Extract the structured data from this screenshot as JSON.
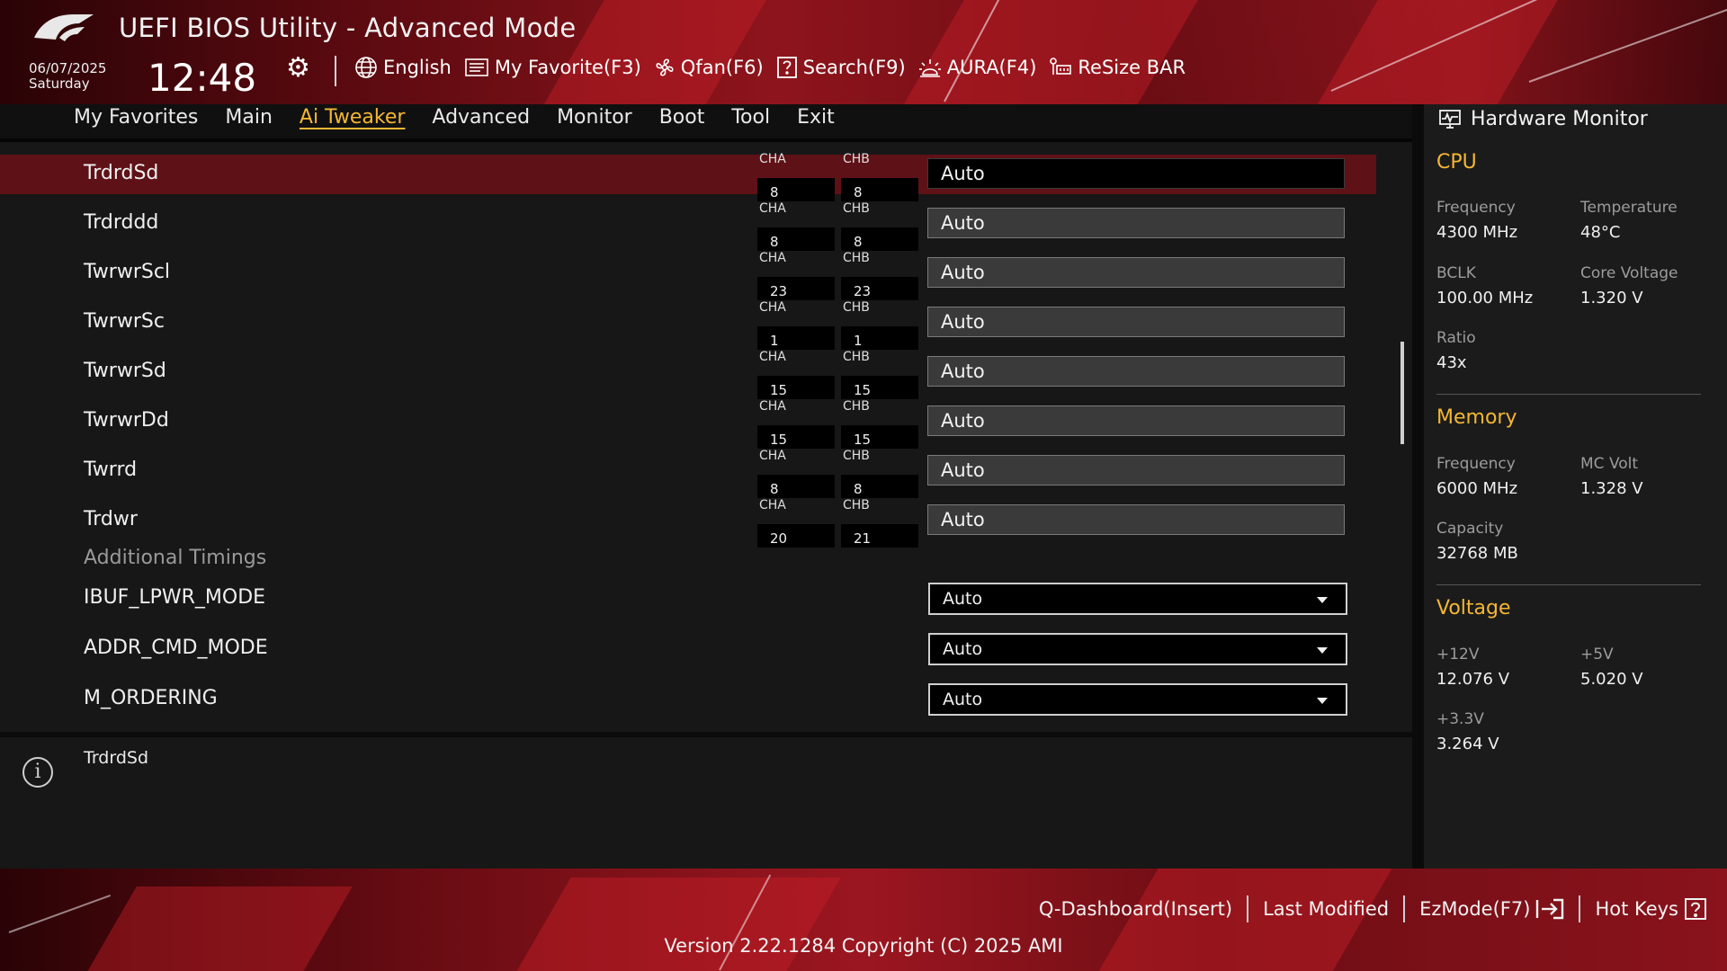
{
  "app": {
    "title": "UEFI BIOS Utility - Advanced Mode"
  },
  "status": {
    "date": "06/07/2025",
    "day": "Saturday",
    "time": "12:48"
  },
  "toolbar": {
    "language": "English",
    "my_favorite": "My Favorite(F3)",
    "qfan": "Qfan(F6)",
    "search": "Search(F9)",
    "aura": "AURA(F4)",
    "resize_bar": "ReSize BAR"
  },
  "tabs": [
    {
      "label": "My Favorites"
    },
    {
      "label": "Main"
    },
    {
      "label": "Ai Tweaker",
      "active": true
    },
    {
      "label": "Advanced"
    },
    {
      "label": "Monitor"
    },
    {
      "label": "Boot"
    },
    {
      "label": "Tool"
    },
    {
      "label": "Exit"
    }
  ],
  "channel_labels": {
    "a": "CHA",
    "b": "CHB"
  },
  "timings": [
    {
      "name": "TrdrdSd",
      "cha": "8",
      "chb": "8",
      "value": "Auto"
    },
    {
      "name": "Trdrddd",
      "cha": "8",
      "chb": "8",
      "value": "Auto"
    },
    {
      "name": "TwrwrScl",
      "cha": "23",
      "chb": "23",
      "value": "Auto"
    },
    {
      "name": "TwrwrSc",
      "cha": "1",
      "chb": "1",
      "value": "Auto"
    },
    {
      "name": "TwrwrSd",
      "cha": "15",
      "chb": "15",
      "value": "Auto"
    },
    {
      "name": "TwrwrDd",
      "cha": "15",
      "chb": "15",
      "value": "Auto"
    },
    {
      "name": "Twrrd",
      "cha": "8",
      "chb": "8",
      "value": "Auto"
    },
    {
      "name": "Trdwr",
      "cha": "20",
      "chb": "21",
      "value": "Auto"
    }
  ],
  "additional_timings_label": "Additional Timings",
  "dropdown_settings": [
    {
      "name": "IBUF_LPWR_MODE",
      "value": "Auto"
    },
    {
      "name": "ADDR_CMD_MODE",
      "value": "Auto"
    },
    {
      "name": "M_ORDERING",
      "value": "Auto"
    }
  ],
  "help": {
    "text": "TrdrdSd"
  },
  "hardware_monitor": {
    "title": "Hardware Monitor",
    "cpu": {
      "label": "CPU",
      "frequency_label": "Frequency",
      "frequency": "4300 MHz",
      "temperature_label": "Temperature",
      "temperature": "48°C",
      "bclk_label": "BCLK",
      "bclk": "100.00 MHz",
      "core_voltage_label": "Core Voltage",
      "core_voltage": "1.320 V",
      "ratio_label": "Ratio",
      "ratio": "43x"
    },
    "memory": {
      "label": "Memory",
      "frequency_label": "Frequency",
      "frequency": "6000 MHz",
      "mc_volt_label": "MC Volt",
      "mc_volt": "1.328 V",
      "capacity_label": "Capacity",
      "capacity": "32768 MB"
    },
    "voltage": {
      "label": "Voltage",
      "v12_label": "+12V",
      "v12": "12.076 V",
      "v5_label": "+5V",
      "v5": "5.020 V",
      "v33_label": "+3.3V",
      "v33": "3.264 V"
    }
  },
  "footer": {
    "q_dashboard": "Q-Dashboard(Insert)",
    "last_modified": "Last Modified",
    "ezmode": "EzMode(F7)",
    "hot_keys": "Hot Keys",
    "version": "Version 2.22.1284 Copyright (C) 2025 AMI"
  },
  "colors": {
    "accent": "#f4b733",
    "selected_row": "#5e1116",
    "brand_red": "#8e141c"
  },
  "icons": [
    "rog-logo-icon",
    "gear-icon",
    "globe-icon",
    "favorite-list-icon",
    "fan-icon",
    "search-help-icon",
    "aura-icon",
    "resize-bar-icon",
    "monitor-icon",
    "info-icon",
    "exit-arrow-icon",
    "help-question-icon",
    "dropdown-caret-icon"
  ]
}
